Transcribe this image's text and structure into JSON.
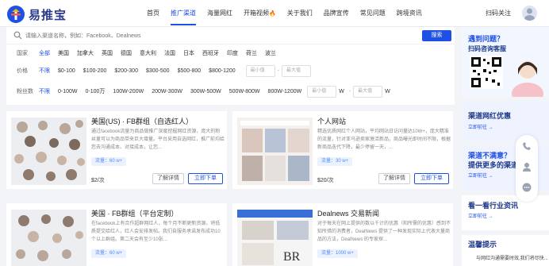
{
  "brand": {
    "logo_text": "易推宝"
  },
  "nav": {
    "items": [
      {
        "label": "首页",
        "active": false,
        "hot": false
      },
      {
        "label": "推广渠道",
        "active": true,
        "hot": false
      },
      {
        "label": "海量网红",
        "active": false,
        "hot": false
      },
      {
        "label": "开箱视频",
        "active": false,
        "hot": true
      },
      {
        "label": "关于我们",
        "active": false,
        "hot": false
      },
      {
        "label": "品牌宣传",
        "active": false,
        "hot": false
      },
      {
        "label": "常见问题",
        "active": false,
        "hot": false
      },
      {
        "label": "跨境资讯",
        "active": false,
        "hot": false
      }
    ],
    "hot_mark": "🔥",
    "follow_label": "扫码关注"
  },
  "search": {
    "placeholder": "请输入渠道名称，例如：Facebook、Dealnews",
    "button_label": "搜索"
  },
  "filters": {
    "country": {
      "label": "国家",
      "options": [
        "全部",
        "美国",
        "加拿大",
        "英国",
        "德国",
        "意大利",
        "法国",
        "日本",
        "西班牙",
        "印度",
        "荷兰",
        "波兰"
      ],
      "selected": 0
    },
    "price": {
      "label": "价格",
      "options": [
        "不限",
        "$0-100",
        "$100-200",
        "$200-300",
        "$300-500",
        "$500-800",
        "$800-1200"
      ],
      "selected": 0,
      "min_placeholder": "最小值",
      "max_placeholder": "最大值",
      "separator": "-"
    },
    "fans": {
      "label": "粉丝数",
      "options": [
        "不限",
        "0-100W",
        "0-100万",
        "100W-200W",
        "200W-300W",
        "300W-500W",
        "500W-800W",
        "800W-1200W"
      ],
      "selected": 0,
      "min_placeholder": "最小值",
      "max_placeholder": "最大值",
      "unit": "W",
      "separator": "-"
    }
  },
  "cards": [
    {
      "title": "美国(US) · FB群组（自选红人）",
      "desc": "通过facebook流量为商品做推广深度挖掘网红资源，庞大的粉丝量可以为商品带来巨大增量。平台采用自选网红，推广前均给您去沟通成本、对接成本，让您...",
      "badge": "流量：60 w+",
      "price": "$2/次",
      "detail_label": "了解详情",
      "order_label": "立即下单",
      "thumb_kind": "grid"
    },
    {
      "title": "个人网站",
      "desc": "精选优质网红个人网站，平均网站日访问量达10W+，庞大精准的流量，针对亚马逊卖家激活新品，商品曝光即时间不限，根据新商品迭代下降，最少停留一天，...",
      "badge": "流量：30 w+",
      "price": "$20/次",
      "detail_label": "了解详情",
      "order_label": "立即下单",
      "thumb_kind": "site"
    },
    {
      "title": "美国 · FB群组（平台定制）",
      "desc": "在facebook上有合作超群网红人，每个月不断更新资源，将低质提交给红人，红人会安排发帖。我们自服务承诺发布成功10个以上群组。第二天会有至少10张...",
      "badge": "流量：60 w+",
      "price": "",
      "detail_label": "",
      "order_label": "",
      "thumb_kind": "grid"
    },
    {
      "title": "Dealnews 交易新闻",
      "desc": "对于每天在网上提供的数以千计的优惠（和所需的优惠）感到不知所措的消费者，DealNews 提供了一种发现实际上代表大量商品的方法，DealNews 的专家探...",
      "badge": "流量：1000 w+",
      "price": "",
      "detail_label": "",
      "order_label": "",
      "thumb_kind": "dealnews"
    }
  ],
  "sidebar": {
    "qr": {
      "title": "遇到问题？",
      "subtitle": "扫码咨询客服"
    },
    "group": {
      "title": "渠道网红优惠",
      "link": "立即前往 →"
    },
    "dissatisfied": {
      "title": "渠道不满意？",
      "subtitle": "提供更多的渠道",
      "link": "立即前往 →"
    },
    "industry": {
      "title": "看一看行业资讯",
      "link": "立即前往 →"
    },
    "tips": {
      "title": "温馨提示",
      "text": "与网红沟通需要时效,我们将尽快..."
    }
  },
  "colors": {
    "accent": "#1e50e6",
    "brand_dark": "#2b3a8c"
  }
}
